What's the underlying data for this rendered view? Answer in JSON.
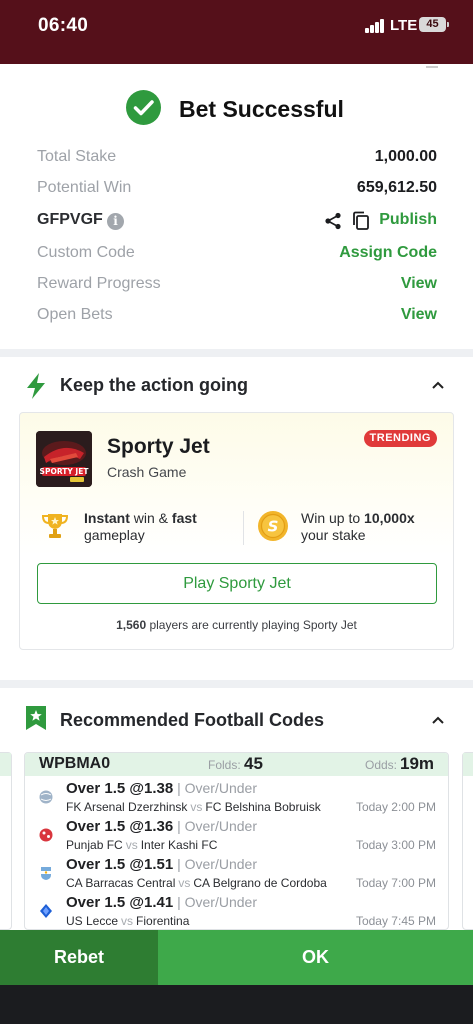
{
  "status_bar": {
    "time": "06:40",
    "network": "LTE",
    "battery": "45"
  },
  "header": {
    "title": "Bet Successful"
  },
  "summary": {
    "total_stake_label": "Total Stake",
    "total_stake_value": "1,000.00",
    "potential_win_label": "Potential Win",
    "potential_win_value": "659,612.50",
    "booking_code": "GFPVGF",
    "publish_label": "Publish",
    "custom_code_label": "Custom Code",
    "custom_code_action": "Assign Code",
    "reward_progress_label": "Reward Progress",
    "reward_progress_action": "View",
    "open_bets_label": "Open Bets",
    "open_bets_action": "View"
  },
  "keep_action": {
    "title": "Keep the action going",
    "game_name": "Sporty Jet",
    "game_type": "Crash Game",
    "badge": "TRENDING",
    "feature1_a": "Instant",
    "feature1_b": " win & ",
    "feature1_c": "fast",
    "feature1_d": "gameplay",
    "feature2_a": "Win up to ",
    "feature2_b": "10,000x",
    "feature2_c": "your stake",
    "play_button": "Play Sporty Jet",
    "players_count": "1,560",
    "players_text": " players are currently playing Sporty Jet",
    "thumb_text": "SPORTY JET"
  },
  "recommended": {
    "title": "Recommended Football Codes",
    "code": "WPBMA0",
    "folds_label": "Folds:",
    "folds_value": "45",
    "odds_label": "Odds:",
    "odds_value": "19m",
    "picks": [
      {
        "market": "Over 1.5 @1.38",
        "type": " | Over/Under",
        "home": "FK Arsenal Dzerzhinsk",
        "away": "FC Belshina Bobruisk",
        "time": "Today 2:00 PM",
        "vs": "vs"
      },
      {
        "market": "Over 1.5 @1.36",
        "type": " | Over/Under",
        "home": "Punjab FC",
        "away": "Inter Kashi FC",
        "time": "Today 3:00 PM",
        "vs": "vs"
      },
      {
        "market": "Over 1.5 @1.51",
        "type": " | Over/Under",
        "home": "CA Barracas Central",
        "away": "CA Belgrano de Cordoba",
        "time": "Today 7:00 PM",
        "vs": "vs"
      },
      {
        "market": "Over 1.5 @1.41",
        "type": " | Over/Under",
        "home": "US Lecce",
        "away": "Fiorentina",
        "time": "Today 7:45 PM",
        "vs": "vs"
      }
    ]
  },
  "actions": {
    "rebet": "Rebet",
    "ok": "OK"
  },
  "colors": {
    "brand_green": "#2f9a3e",
    "ok_green": "#3ea94a",
    "rebet_green": "#2e7d32",
    "badge_red": "#e03a3a",
    "status_bar": "#55101a"
  }
}
